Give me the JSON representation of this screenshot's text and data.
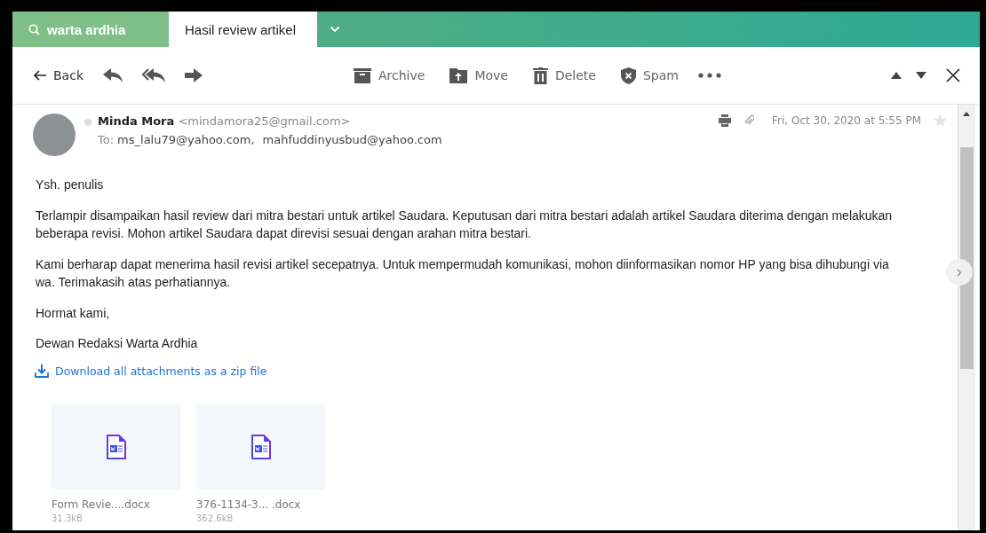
{
  "tabs": [
    {
      "kind": "search",
      "label": "warta ardhia",
      "selected": false
    },
    {
      "kind": "message",
      "label": "Hasil review artikel",
      "selected": true
    }
  ],
  "toolbar": {
    "back": "Back",
    "actions": [
      {
        "kind": "archive",
        "label": "Archive"
      },
      {
        "kind": "move",
        "label": "Move"
      },
      {
        "kind": "delete",
        "label": "Delete"
      },
      {
        "kind": "spam",
        "label": "Spam"
      }
    ]
  },
  "message": {
    "sender_name": "Minda Mora",
    "sender_email": "<mindamora25@gmail.com>",
    "to_label": "To:",
    "recipients": [
      "ms_lalu79@yahoo.com,",
      "mahfuddinyusbud@yahoo.com"
    ],
    "date": "Fri, Oct 30, 2020 at 5:55 PM",
    "starred": false,
    "body": [
      "Ysh. penulis",
      "Terlampir disampaikan hasil review dari mitra bestari untuk artikel Saudara. Keputusan dari mitra bestari adalah artikel Saudara diterima dengan melakukan beberapa revisi. Mohon artikel Saudara dapat direvisi sesuai dengan arahan mitra bestari.",
      "Kami berharap dapat menerima hasil revisi artikel secepatnya. Untuk mempermudah komunikasi, mohon diinformasikan nomor HP yang bisa dihubungi via wa. Terimakasih atas perhatiannya.",
      "Hormat kami,",
      "Dewan Redaksi Warta Ardhia"
    ],
    "download_link": "Download all attachments as a zip file",
    "attachments": [
      {
        "name": "Form Revie....docx",
        "size": "31.3kB"
      },
      {
        "name": "376-1134-3... .docx",
        "size": "362.6kB"
      }
    ]
  }
}
